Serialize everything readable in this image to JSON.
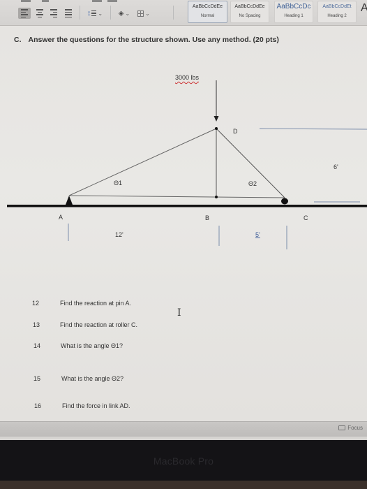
{
  "ribbon": {
    "paragraph_buttons": [
      {
        "name": "align-left",
        "active": true
      },
      {
        "name": "align-center",
        "active": false
      },
      {
        "name": "align-right",
        "active": false
      },
      {
        "name": "justify",
        "active": false
      }
    ],
    "styles": [
      {
        "sample": "AaBbCcDdEe",
        "label": "Normal",
        "selected": true
      },
      {
        "sample": "AaBbCcDdEe",
        "label": "No Spacing",
        "selected": false
      },
      {
        "sample": "AaBbCcDc",
        "label": "Heading 1",
        "selected": false
      },
      {
        "sample": "AaBbCcDdEt",
        "label": "Heading 2",
        "selected": false
      }
    ],
    "styles_more_glyph": "A"
  },
  "document": {
    "title_prefix": "C.",
    "title": "Answer the questions for the structure shown.  Use any method.  (20 pts)",
    "diagram": {
      "load_label": "3000 lbs",
      "node_labels": {
        "A": "A",
        "B": "B",
        "C": "C",
        "D": "D"
      },
      "angle_labels": {
        "theta1": "Θ1",
        "theta2": "Θ2"
      },
      "dimensions": {
        "ab": "12'",
        "bc": "5'",
        "height": "6'"
      }
    },
    "questions": [
      {
        "number": "12",
        "text": "Find the reaction at pin A."
      },
      {
        "number": "13",
        "text": "Find the reaction at roller C."
      },
      {
        "number": "14",
        "text": "What is the angle Θ1?"
      },
      {
        "number": "15",
        "text": "What is the angle Θ2?"
      },
      {
        "number": "16",
        "text": "Find the force in link AD."
      }
    ]
  },
  "statusbar": {
    "focus_label": "Focus"
  },
  "device": {
    "bezel_label": "MacBook Pro"
  },
  "colors": {
    "line_blue": "#8e9cb5",
    "member": "#555555",
    "ground": "#111111"
  }
}
